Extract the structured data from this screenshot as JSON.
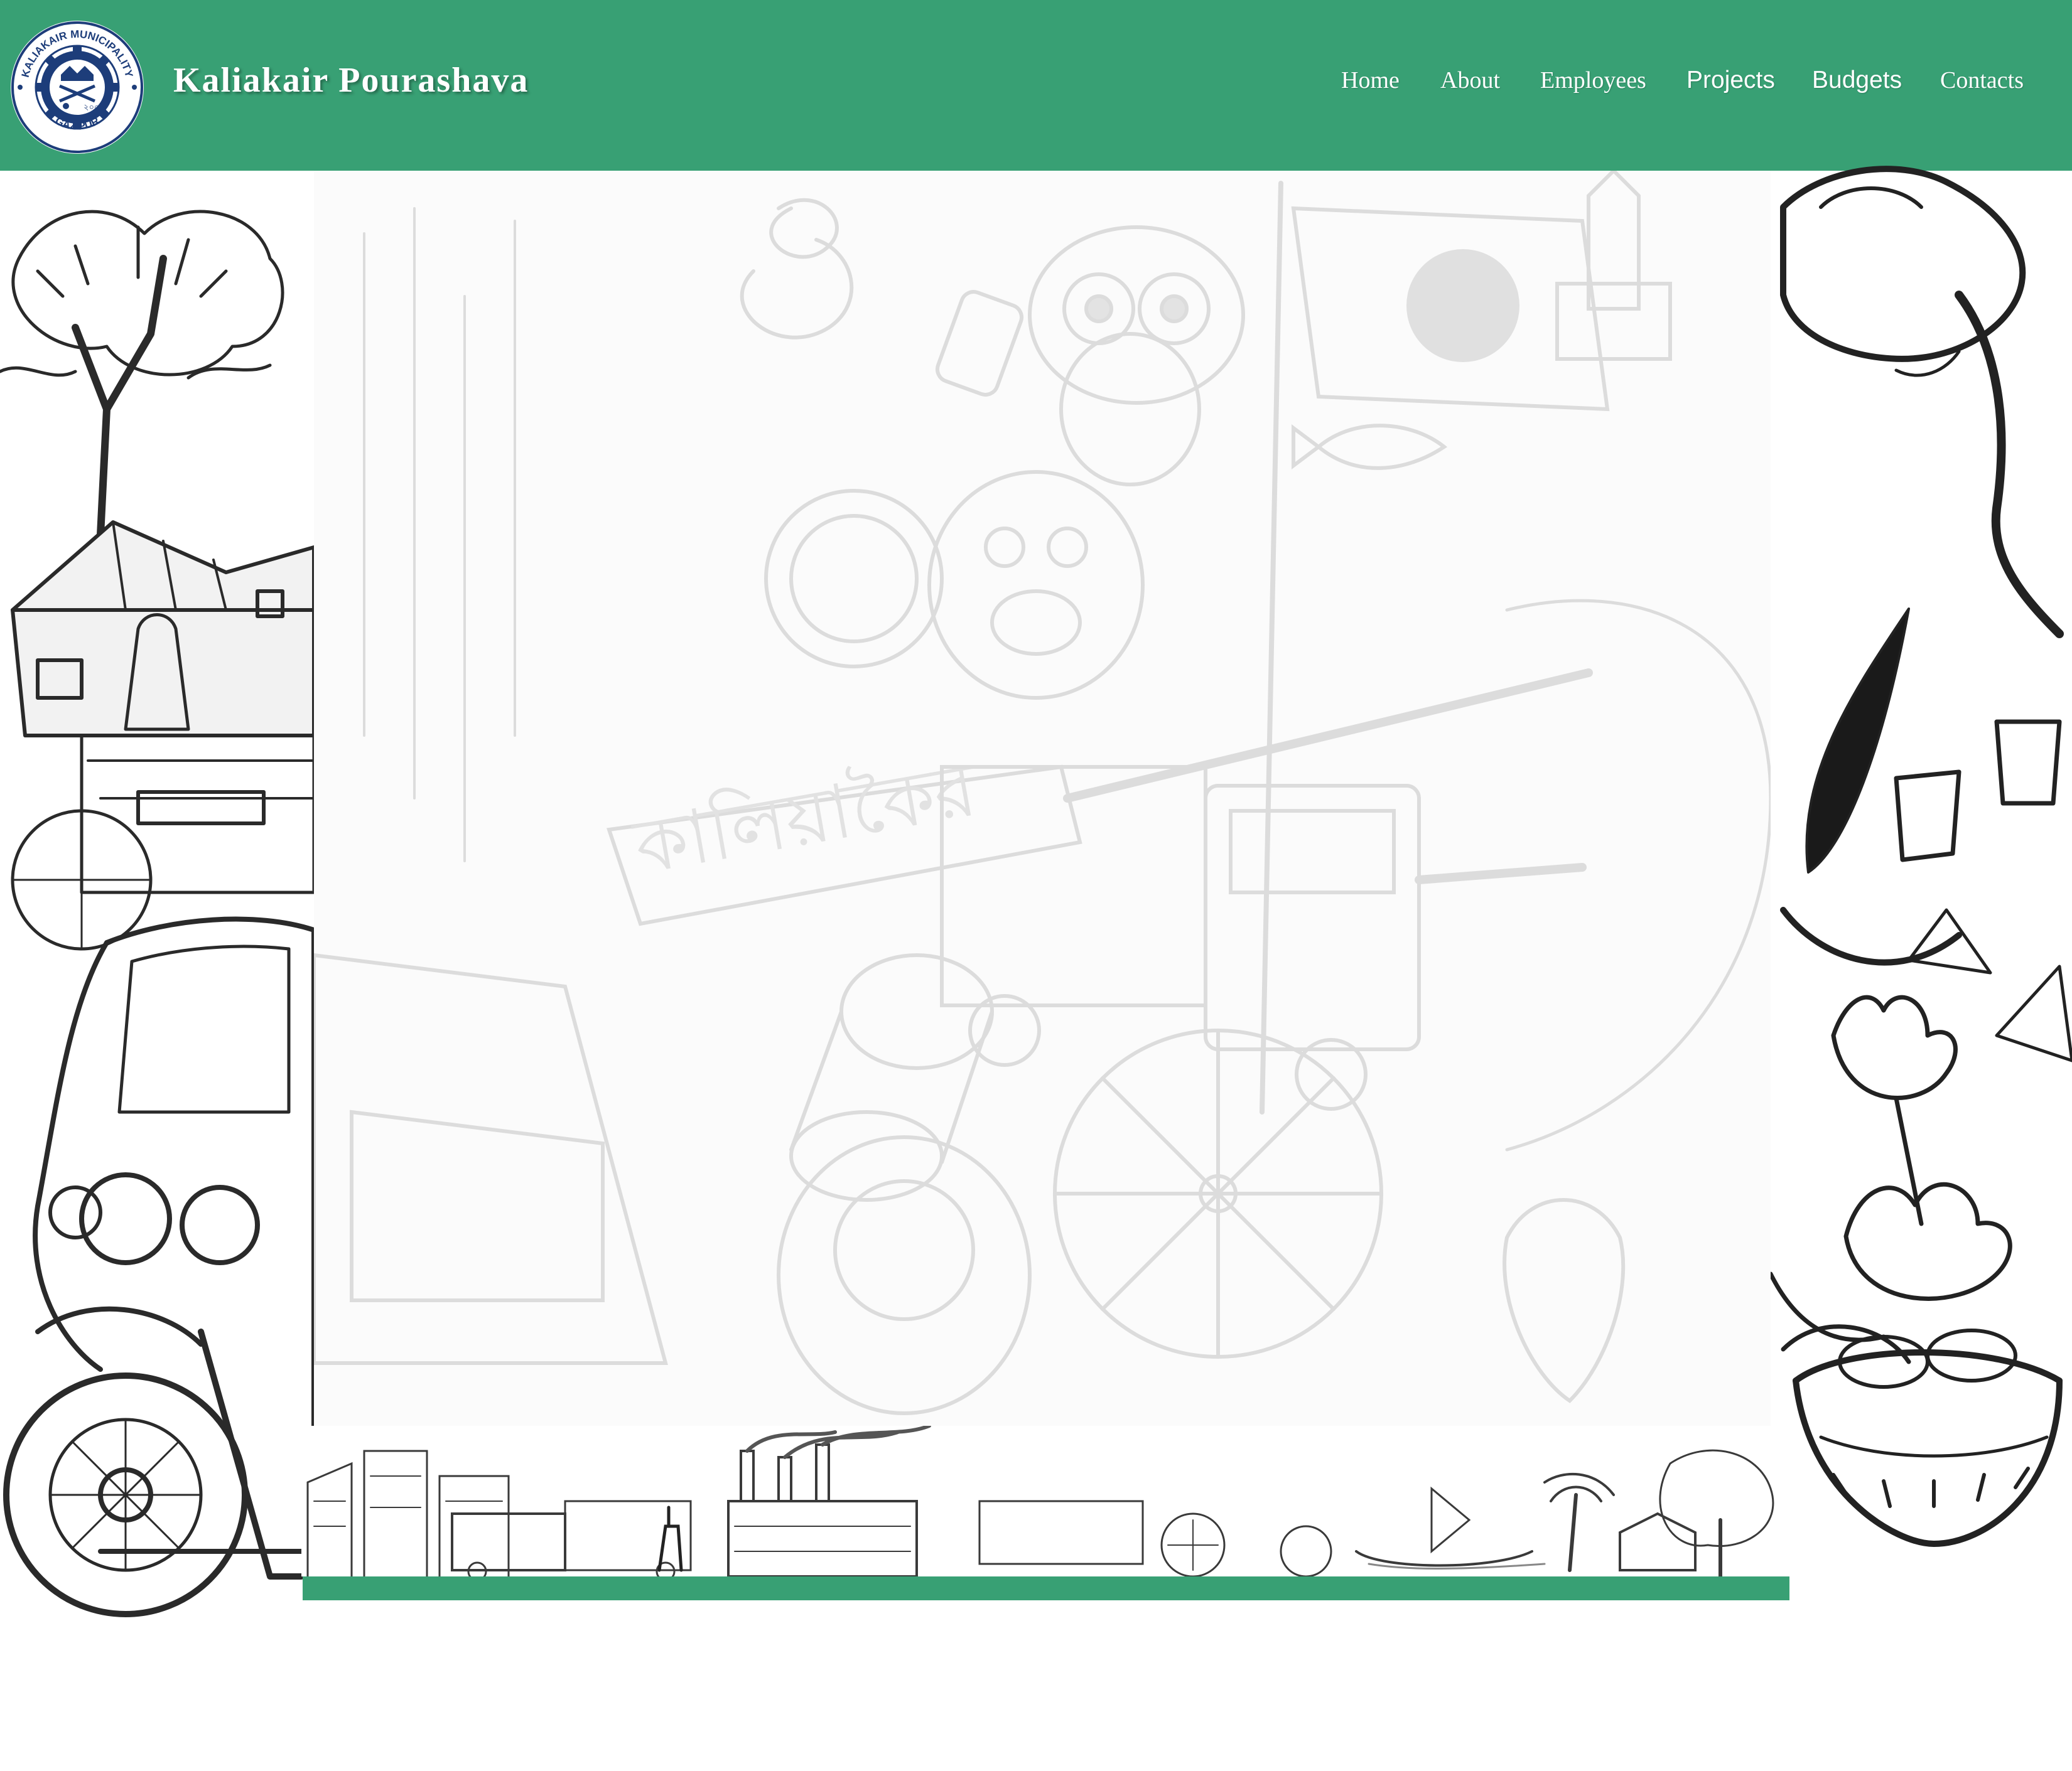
{
  "header": {
    "title": "Kaliakair Pourashava",
    "logo": {
      "ring_text_top": "KALIAKAIR MUNICIPALITY",
      "ring_text_bottom": "GAZIPUR",
      "icon": "municipality-seal"
    }
  },
  "nav": {
    "items": [
      {
        "label": "Home"
      },
      {
        "label": "About"
      },
      {
        "label": "Employees"
      },
      {
        "label": "Projects"
      },
      {
        "label": "Budgets"
      },
      {
        "label": "Contacts"
      }
    ]
  },
  "colors": {
    "header_green": "#38a074",
    "sketch_dark": "#1f1f1f",
    "sketch_faint": "#d9d9d9",
    "background": "#fbfbfb"
  }
}
